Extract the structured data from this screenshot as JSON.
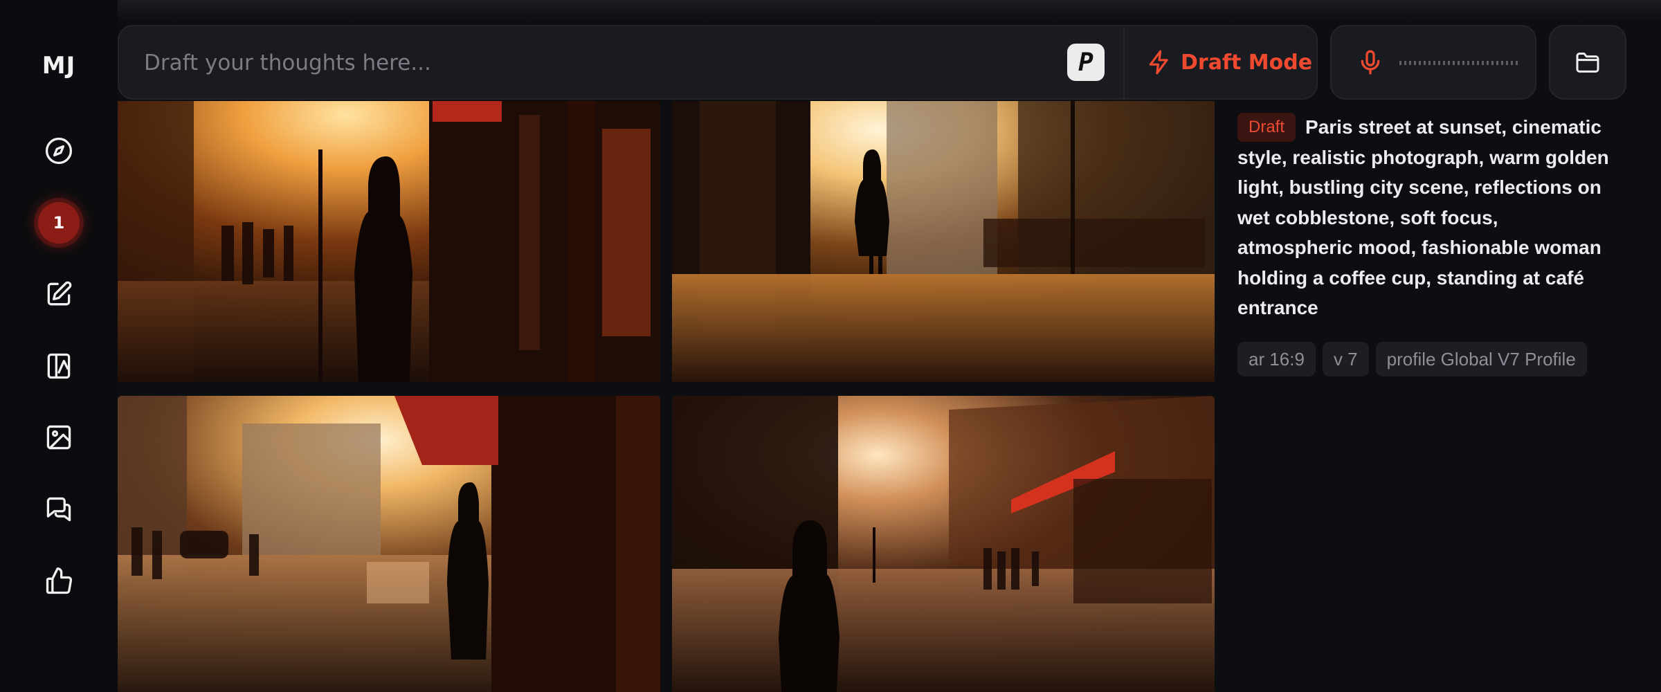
{
  "sidebar": {
    "logo": "MJ",
    "badge_count": "1",
    "items": [
      {
        "icon": "compass-icon"
      },
      {
        "icon": "edit-icon"
      },
      {
        "icon": "organize-icon"
      },
      {
        "icon": "image-icon"
      },
      {
        "icon": "chat-icon"
      },
      {
        "icon": "thumbs-up-icon"
      }
    ]
  },
  "prompt_bar": {
    "placeholder": "Draft your thoughts here...",
    "p_button": "P",
    "draft_mode_label": "Draft Mode"
  },
  "colors": {
    "accent": "#ef4a2f",
    "background": "#0d0e12",
    "panel": "#1a1b20",
    "badge": "#8b1d16"
  },
  "images": [
    {
      "name": "image-1"
    },
    {
      "name": "image-2"
    },
    {
      "name": "image-3"
    },
    {
      "name": "image-4"
    }
  ],
  "details": {
    "tag": "Draft",
    "prompt": "Paris street at sunset, cinematic style, realistic photograph, warm golden light, bustling city scene, reflections on wet cobblestone, soft focus, atmospheric mood, fashionable woman holding a coffee cup, standing at café entrance",
    "params": [
      "ar 16:9",
      "v 7",
      "profile Global V7 Profile"
    ]
  }
}
